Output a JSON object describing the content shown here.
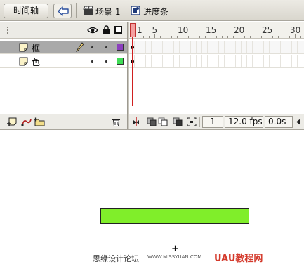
{
  "toolbar": {
    "timeline_button": "时间轴",
    "scene_label": "场景 1",
    "symbol_label": "进度条"
  },
  "layers": [
    {
      "name": "框",
      "selected": true,
      "color": "#8b3fbd"
    },
    {
      "name": "色",
      "selected": false,
      "color": "#3fdc56"
    }
  ],
  "ruler": {
    "ticks": [
      "1",
      "5",
      "10",
      "15",
      "20",
      "25",
      "30"
    ]
  },
  "timeline_footer": {
    "current_frame": "1",
    "frame_rate": "12.0 fps",
    "elapsed_time": "0.0s"
  },
  "stage": {
    "bar_color": "#80ee2a",
    "registration_mark": "+"
  },
  "watermark": {
    "left_text": "思缘设计论坛",
    "url": "WWW.MISSYUAN.COM",
    "logo_text": "UAU教程网"
  },
  "icons": [
    "back-arrow-icon",
    "scene-icon",
    "symbol-icon",
    "eye-icon",
    "lock-icon",
    "outline-icon",
    "layer-icon",
    "pencil-icon",
    "add-layer-icon",
    "add-guide-layer-icon",
    "add-folder-icon",
    "trash-icon",
    "center-frame-icon",
    "onion-skin-icon",
    "onion-outline-icon",
    "edit-multiple-frames-icon",
    "onion-markers-icon",
    "scroll-left-icon"
  ]
}
